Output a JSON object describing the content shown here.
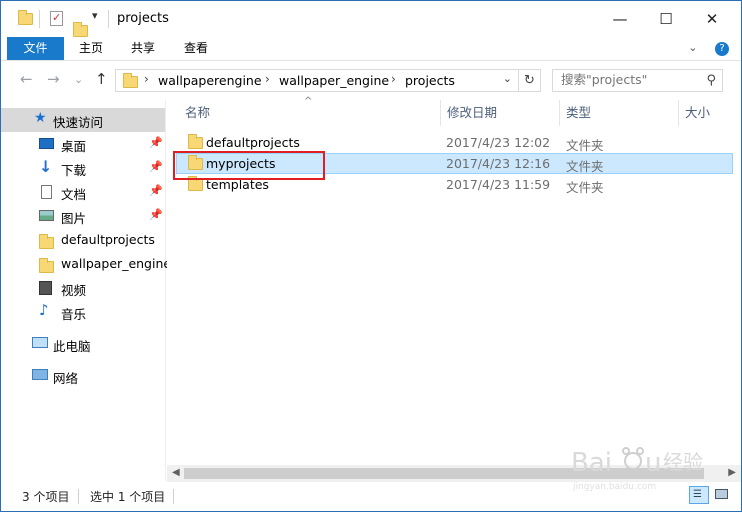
{
  "window": {
    "title": "projects",
    "controls": {
      "minimize": "—",
      "maximize": "☐",
      "close": "✕"
    }
  },
  "ribbon": {
    "tabs": [
      "文件",
      "主页",
      "共享",
      "查看"
    ],
    "collapse": "⌄",
    "help": "?"
  },
  "address": {
    "crumbs": [
      "wallpaperengine",
      "wallpaper_engine",
      "projects"
    ],
    "separator": "›",
    "dropdown": "⌄",
    "refresh": "↻"
  },
  "search": {
    "placeholder": "搜索\"projects\""
  },
  "nav": {
    "back": "←",
    "forward": "→",
    "recent": "⌄",
    "up": "↑"
  },
  "navpane": {
    "quick_access": "快速访问",
    "items": [
      {
        "label": "桌面",
        "icon": "desktop-icon",
        "pinned": true
      },
      {
        "label": "下载",
        "icon": "download-icon",
        "pinned": true
      },
      {
        "label": "文档",
        "icon": "document-icon",
        "pinned": true
      },
      {
        "label": "图片",
        "icon": "picture-icon",
        "pinned": true
      },
      {
        "label": "defaultprojects",
        "icon": "folder-icon",
        "pinned": false
      },
      {
        "label": "wallpaper_engine",
        "icon": "folder-icon",
        "pinned": false
      },
      {
        "label": "视频",
        "icon": "video-icon",
        "pinned": false
      },
      {
        "label": "音乐",
        "icon": "music-icon",
        "pinned": false
      }
    ],
    "this_pc": "此电脑",
    "network": "网络"
  },
  "columns": {
    "name": "名称",
    "date": "修改日期",
    "type": "类型",
    "size": "大小"
  },
  "files": [
    {
      "name": "defaultprojects",
      "date": "2017/4/23 12:02",
      "type": "文件夹"
    },
    {
      "name": "myprojects",
      "date": "2017/4/23 12:16",
      "type": "文件夹"
    },
    {
      "name": "templates",
      "date": "2017/4/23 11:59",
      "type": "文件夹"
    }
  ],
  "status": {
    "count": "3 个项目",
    "selected": "选中 1 个项目"
  },
  "colors": {
    "accent": "#1979ca",
    "selection": "#cce8ff",
    "highlight": "#e02020",
    "folder": "#f8d775"
  }
}
